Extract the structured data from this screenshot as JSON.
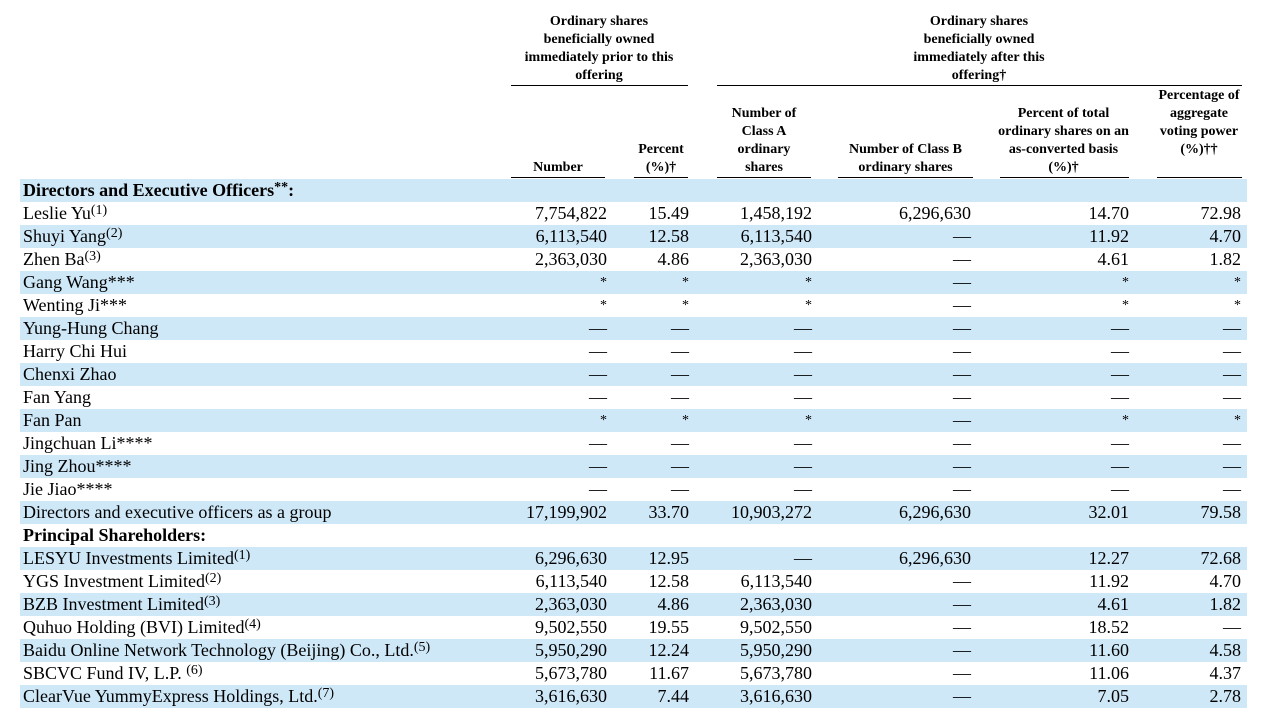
{
  "header": {
    "group_prior": "Ordinary shares beneficially owned immediately prior to this offering",
    "group_after": "Ordinary shares beneficially owned immediately after this offering†",
    "col_number": "Number",
    "col_percent": "Percent (%)†",
    "col_class_a": "Number of Class A ordinary shares",
    "col_class_b": "Number of Class B ordinary shares",
    "col_pct_total": "Percent of total ordinary shares on an as-converted basis (%)†",
    "col_voting": "Percentage of aggregate voting power (%)††"
  },
  "rows": [
    {
      "name": "Directors and Executive Officers",
      "sup": "**",
      "suffix": ":",
      "bold": true,
      "shade": true,
      "values": [
        "",
        "",
        "",
        "",
        "",
        ""
      ]
    },
    {
      "name": "Leslie Yu",
      "sup": "(1)",
      "shade": false,
      "values": [
        "7,754,822",
        "15.49",
        "1,458,192",
        "6,296,630",
        "14.70",
        "72.98"
      ]
    },
    {
      "name": "Shuyi Yang",
      "sup": "(2)",
      "shade": true,
      "values": [
        "6,113,540",
        "12.58",
        "6,113,540",
        "—",
        "11.92",
        "4.70"
      ]
    },
    {
      "name": "Zhen Ba",
      "sup": "(3)",
      "shade": false,
      "values": [
        "2,363,030",
        "4.86",
        "2,363,030",
        "—",
        "4.61",
        "1.82"
      ]
    },
    {
      "name": "Gang Wang***",
      "sup": "",
      "shade": true,
      "values": [
        "*",
        "*",
        "*",
        "—",
        "*",
        "*"
      ]
    },
    {
      "name": "Wenting Ji***",
      "sup": "",
      "shade": false,
      "values": [
        "*",
        "*",
        "*",
        "—",
        "*",
        "*"
      ]
    },
    {
      "name": "Yung-Hung Chang",
      "sup": "",
      "shade": true,
      "values": [
        "—",
        "—",
        "—",
        "—",
        "—",
        "—"
      ]
    },
    {
      "name": "Harry Chi Hui",
      "sup": "",
      "shade": false,
      "values": [
        "—",
        "—",
        "—",
        "—",
        "—",
        "—"
      ]
    },
    {
      "name": "Chenxi Zhao",
      "sup": "",
      "shade": true,
      "values": [
        "—",
        "—",
        "—",
        "—",
        "—",
        "—"
      ]
    },
    {
      "name": "Fan Yang",
      "sup": "",
      "shade": false,
      "values": [
        "—",
        "—",
        "—",
        "—",
        "—",
        "—"
      ]
    },
    {
      "name": "Fan Pan",
      "sup": "",
      "shade": true,
      "values": [
        "*",
        "*",
        "*",
        "—",
        "*",
        "*"
      ]
    },
    {
      "name": "Jingchuan Li****",
      "sup": "",
      "shade": false,
      "values": [
        "—",
        "—",
        "—",
        "—",
        "—",
        "—"
      ]
    },
    {
      "name": "Jing Zhou****",
      "sup": "",
      "shade": true,
      "values": [
        "—",
        "—",
        "—",
        "—",
        "—",
        "—"
      ]
    },
    {
      "name": "Jie Jiao****",
      "sup": "",
      "shade": false,
      "values": [
        "—",
        "—",
        "—",
        "—",
        "—",
        "—"
      ]
    },
    {
      "name": "Directors and executive officers as a group",
      "sup": "",
      "shade": true,
      "values": [
        "17,199,902",
        "33.70",
        "10,903,272",
        "6,296,630",
        "32.01",
        "79.58"
      ]
    },
    {
      "name": "Principal Shareholders:",
      "sup": "",
      "bold": true,
      "shade": false,
      "values": [
        "",
        "",
        "",
        "",
        "",
        ""
      ]
    },
    {
      "name": "LESYU Investments Limited",
      "sup": "(1)",
      "shade": true,
      "values": [
        "6,296,630",
        "12.95",
        "—",
        "6,296,630",
        "12.27",
        "72.68"
      ]
    },
    {
      "name": "YGS Investment Limited",
      "sup": "(2)",
      "shade": false,
      "values": [
        "6,113,540",
        "12.58",
        "6,113,540",
        "—",
        "11.92",
        "4.70"
      ]
    },
    {
      "name": "BZB Investment Limited",
      "sup": "(3)",
      "shade": true,
      "values": [
        "2,363,030",
        "4.86",
        "2,363,030",
        "—",
        "4.61",
        "1.82"
      ]
    },
    {
      "name": "Quhuo Holding (BVI) Limited",
      "sup": "(4)",
      "shade": false,
      "values": [
        "9,502,550",
        "19.55",
        "9,502,550",
        "—",
        "18.52",
        "—"
      ]
    },
    {
      "name": "Baidu Online Network Technology (Beijing) Co., Ltd.",
      "sup": "(5)",
      "shade": true,
      "values": [
        "5,950,290",
        "12.24",
        "5,950,290",
        "—",
        "11.60",
        "4.58"
      ]
    },
    {
      "name": "SBCVC Fund IV, L.P. ",
      "sup": "(6)",
      "shade": false,
      "values": [
        "5,673,780",
        "11.67",
        "5,673,780",
        "—",
        "11.06",
        "4.37"
      ]
    },
    {
      "name": "ClearVue YummyExpress Holdings, Ltd.",
      "sup": "(7)",
      "shade": true,
      "values": [
        "3,616,630",
        "7.44",
        "3,616,630",
        "—",
        "7.05",
        "2.78"
      ]
    }
  ]
}
